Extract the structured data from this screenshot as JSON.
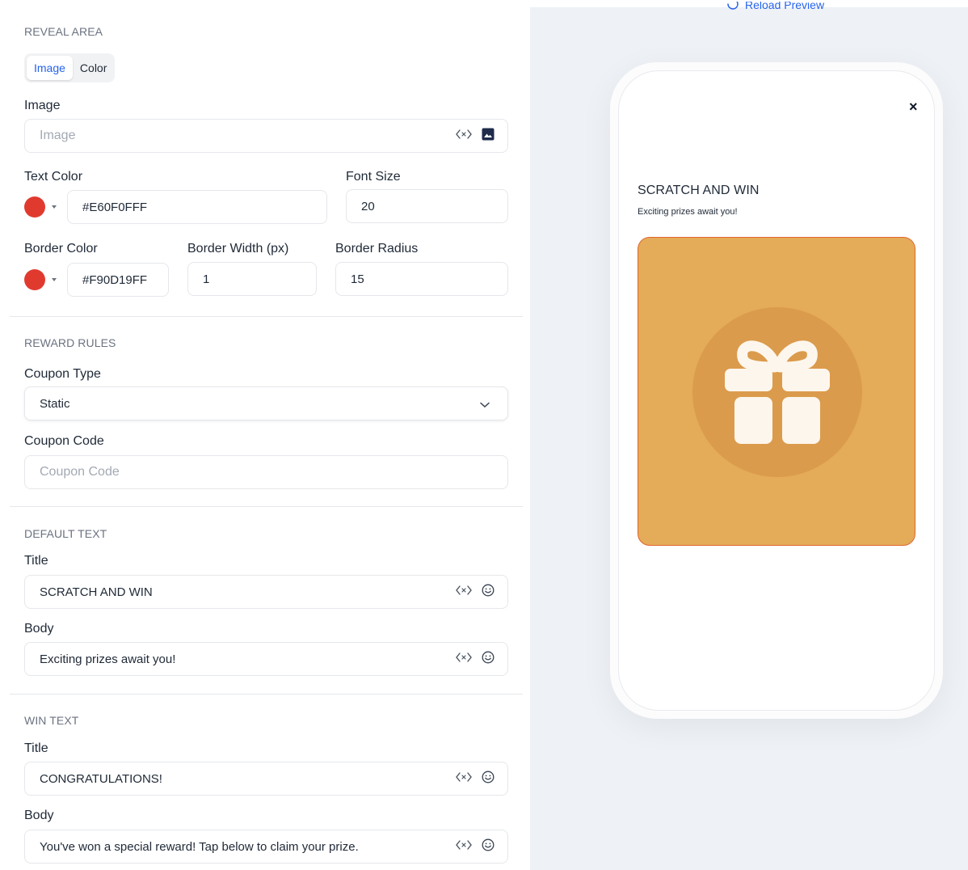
{
  "reveal": {
    "section_title": "REVEAL AREA",
    "tabs": [
      {
        "label": "Image",
        "active": true
      },
      {
        "label": "Color",
        "active": false
      }
    ],
    "image_label": "Image",
    "image_placeholder": "Image",
    "text_color_label": "Text Color",
    "text_color_value": "#E60F0FFF",
    "font_size_label": "Font Size",
    "font_size_value": "20",
    "border_color_label": "Border Color",
    "border_color_value": "#F90D19FF",
    "border_width_label": "Border Width (px)",
    "border_width_value": "1",
    "border_radius_label": "Border Radius",
    "border_radius_value": "15"
  },
  "reward": {
    "section_title": "REWARD RULES",
    "coupon_type_label": "Coupon Type",
    "coupon_type_value": "Static",
    "coupon_code_label": "Coupon Code",
    "coupon_code_placeholder": "Coupon Code"
  },
  "default_text": {
    "section_title": "DEFAULT TEXT",
    "title_label": "Title",
    "title_value": "SCRATCH AND WIN",
    "body_label": "Body",
    "body_value": "Exciting prizes await you!"
  },
  "win_text": {
    "section_title": "WIN TEXT",
    "title_label": "Title",
    "title_value": "CONGRATULATIONS!",
    "body_label": "Body",
    "body_value": "You've won a special reward! Tap below to claim your prize."
  },
  "preview": {
    "reload_label": "Reload Preview",
    "close_glyph": "×",
    "title": "SCRATCH AND WIN",
    "body": "Exciting prizes await you!"
  },
  "colors": {
    "accent": "#2563eb",
    "swatch_red": "#e03a2f",
    "scratch_fill": "#e4ab58",
    "scratch_border": "#e0662f",
    "gift_circle": "#db9b4c",
    "gift_glyph": "#fdf6ec"
  },
  "icons": {
    "variable": "variable-code-icon",
    "image": "image-icon",
    "emoji": "emoji-icon",
    "chevron": "chevron-down-icon",
    "reload": "reload-icon",
    "close": "close-icon",
    "gift": "gift-icon"
  }
}
